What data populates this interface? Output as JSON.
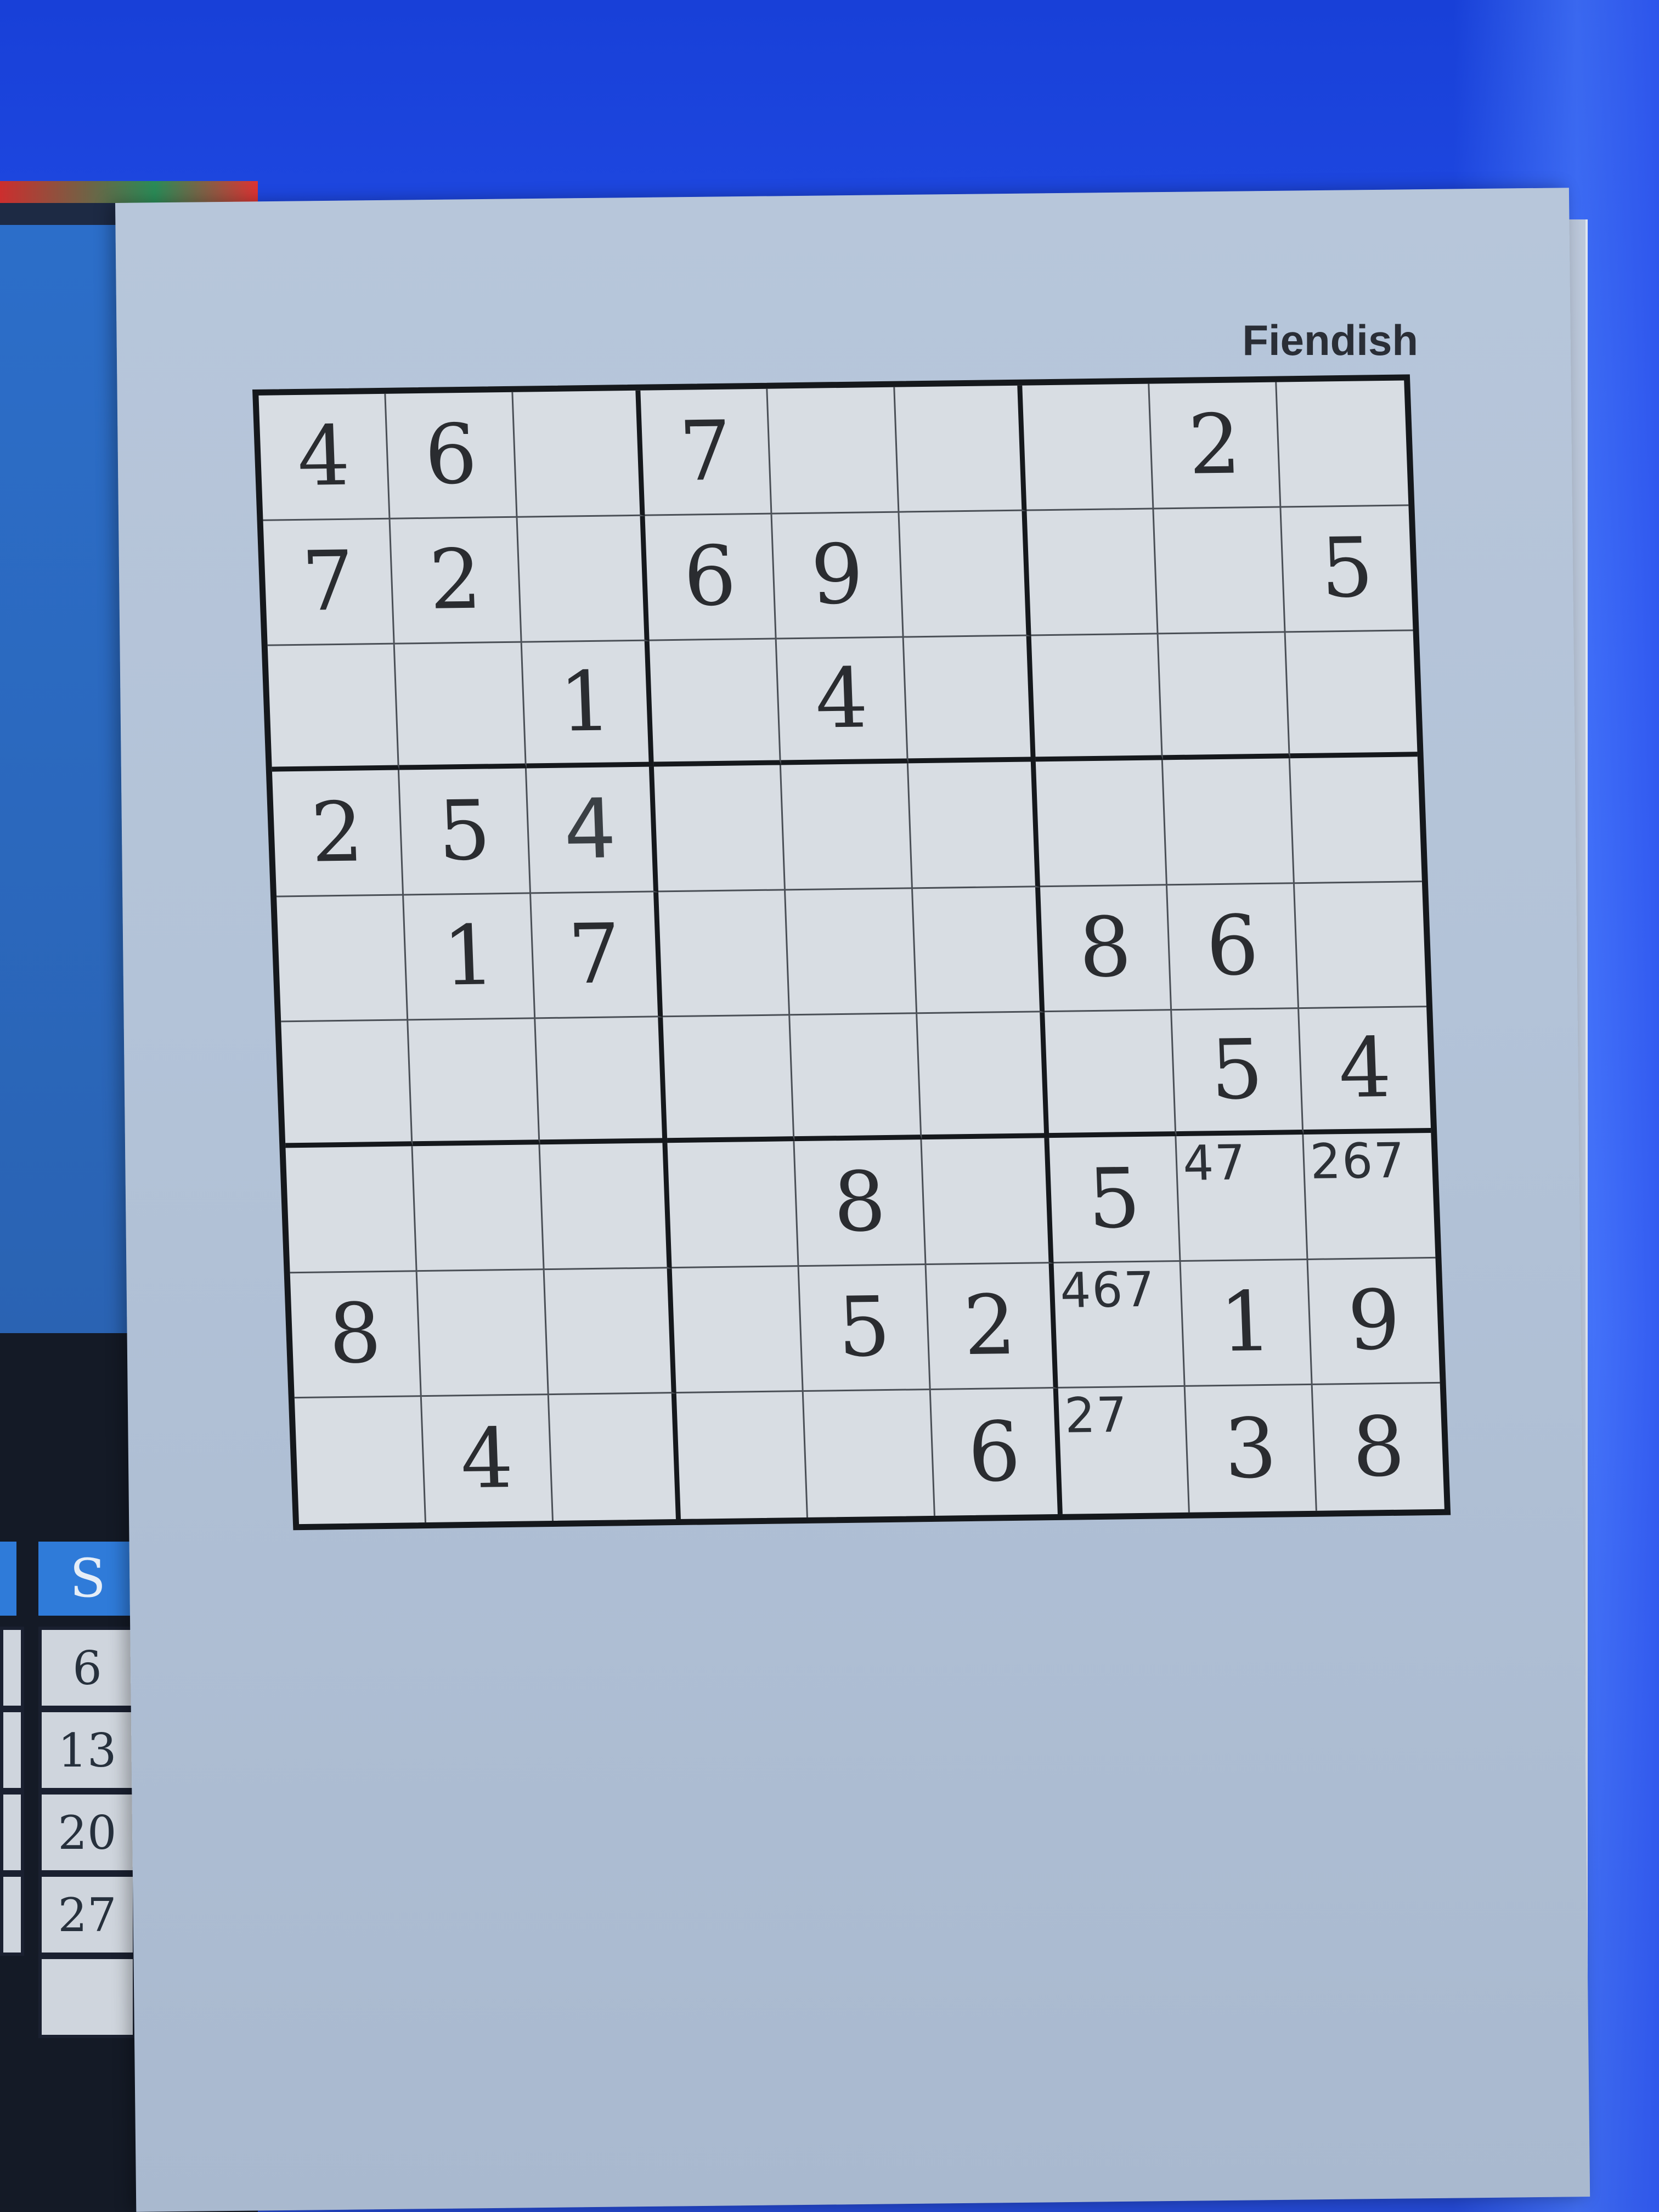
{
  "puzzle": {
    "difficulty": "Fiendish",
    "grid": [
      [
        "4",
        "6",
        "",
        "7",
        "",
        "",
        "",
        "2",
        ""
      ],
      [
        "7",
        "2",
        "",
        "6",
        "9",
        "",
        "",
        "",
        "5"
      ],
      [
        "",
        "",
        "1",
        "",
        "4",
        "",
        "",
        "",
        ""
      ],
      [
        "2",
        "5",
        "4",
        "",
        "",
        "",
        "",
        "",
        ""
      ],
      [
        "",
        "1",
        "7",
        "",
        "",
        "",
        "8",
        "6",
        ""
      ],
      [
        "",
        "",
        "",
        "",
        "",
        "",
        "",
        "5",
        "4"
      ],
      [
        "",
        "",
        "",
        "",
        "8",
        "",
        "5",
        "",
        ""
      ],
      [
        "8",
        "",
        "",
        "",
        "5",
        "2",
        "",
        "1",
        "9"
      ],
      [
        "",
        "4",
        "",
        "",
        "",
        "6",
        "",
        "3",
        "8"
      ]
    ],
    "handwritten_digits": [
      {
        "row": 3,
        "col": 2,
        "value": "4"
      }
    ],
    "pencil_marks": [
      {
        "row": 6,
        "col": 7,
        "value": "47"
      },
      {
        "row": 6,
        "col": 8,
        "value": "267"
      },
      {
        "row": 7,
        "col": 6,
        "value": "467"
      },
      {
        "row": 8,
        "col": 6,
        "value": "27"
      }
    ]
  },
  "calendar": {
    "day_header": "S",
    "dates": [
      "6",
      "13",
      "20",
      "27",
      ""
    ]
  },
  "colors": {
    "background": "#2a55ef",
    "paper": "#b3c3d8",
    "grid_cell": "#d8dde3",
    "grid_line": "#15181c",
    "calendar_header": "#2f7bd9"
  }
}
